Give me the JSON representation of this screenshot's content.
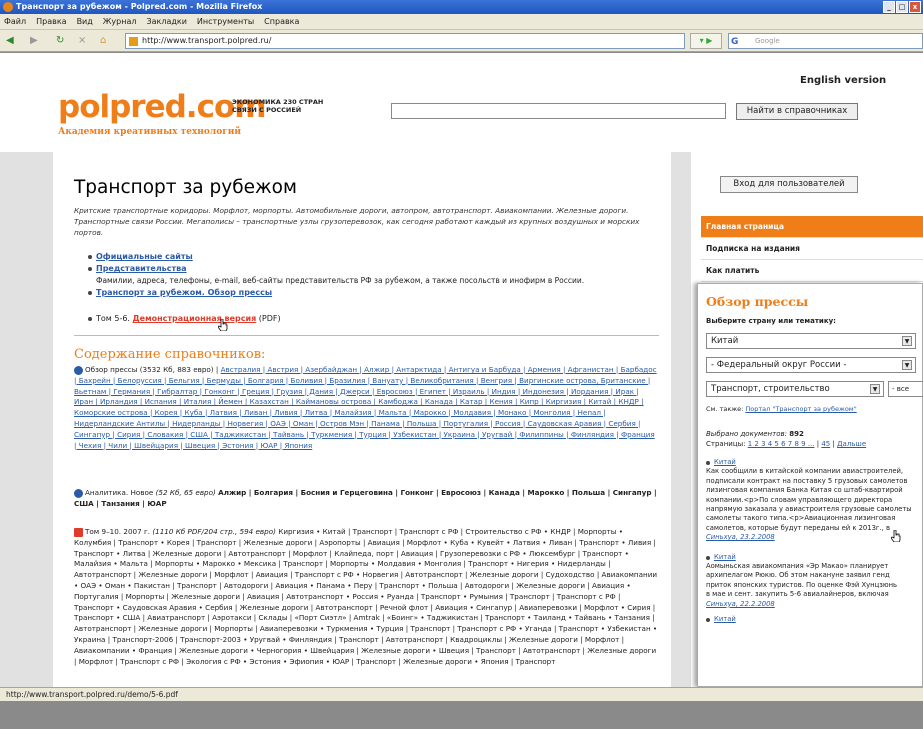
{
  "window": {
    "title": "Транспорт за рубежом - Polpred.com - Mozilla Firefox"
  },
  "menu": [
    "Файл",
    "Правка",
    "Вид",
    "Журнал",
    "Закладки",
    "Инструменты",
    "Справка"
  ],
  "nav": {
    "url": "http://www.transport.polpred.ru/",
    "search_placeholder": "Google"
  },
  "header": {
    "english": "English version",
    "logo": "polpred.com",
    "logo_sub": "Академия креативных технологий",
    "econ_line1": "ЭКОНОМИКА 230 СТРАН",
    "econ_line2": "СВЯЗИ С РОССИЕЙ",
    "search_button": "Найти в справочниках"
  },
  "main": {
    "title": "Транспорт за рубежом",
    "intro": "Критские транспортные коридоры. Морфлот, морпорты. Автомобильные дороги, автопром, автотранспорт. Авиакомпании. Железные дороги. Транспортные связи России. Мегаполисы – транспортные узлы грузоперевозок, как сегодня работают каждый из крупных воздушных и морских портов.",
    "link1": "Официальные сайты",
    "link2": "Представительства",
    "link2_desc": "Фамилии, адреса, телефоны, e-mail, веб-сайты представительств РФ за рубежом, а также посольств и инофирм в России.",
    "link3": "Транспорт за рубежом. Обзор прессы",
    "tom_prefix": "Том 5-6.",
    "tom_link": "Демонстрационная версия",
    "tom_suffix": "(PDF)",
    "contents_title": "Содержание справочников:",
    "block1_lead": "Обзор прессы (3532 Кб, 883 евро) |",
    "block1_countries": "Австралия | Австрия | Азербайджан | Алжир | Антарктида | Антигуа и Барбуда | Армения | Афганистан | Барбадос | Бахрейн | Белоруссия | Бельгия | Бермуды | Болгария | Боливия | Бразилия | Вануату | Великобритания | Венгрия | Виргинские острова, Британские | Вьетнам | Германия | Гибралтар | Гонконг | Греция | Грузия | Дания | Джерси | Евросоюз | Египет | Израиль | Индия | Индонезия | Иордания | Ирак | Иран | Ирландия | Испания | Италия | Йемен | Казахстан | Каймановы острова | Камбоджа | Канада | Катар | Кения | Кипр | Киргизия | Китай | КНДР | Коморские острова | Корея | Куба | Латвия | Ливан | Ливия | Литва | Малайзия | Мальта | Марокко | Молдавия | Монако | Монголия | Непал | Нидерландские Антилы | Нидерланды | Норвегия | ОАЭ | Оман | Остров Мэн | Панама | Польша | Португалия | Россия | Саудовская Аравия | Сербия | Сингапур | Сирия | Словакия | США | Таджикистан | Тайвань | Туркмения | Турция | Узбекистан | Украина | Уругвай | Филиппины | Финляндия | Франция | Чехия | Чили | Швейцария | Швеция | Эстония | ЮАР | Япония",
    "block2_lead": "Аналитика. Новое",
    "block2_meta": "(52 Кб, 65 евро)",
    "block2_text": "Алжир | Болгария | Босния и Герцеговина | Гонконг | Евросоюз | Канада | Марокко | Польша | Сингапур | США | Танзания | ЮАР",
    "block3_lead": "Том 9–10. 2007 г.",
    "block3_meta": "(1110 Кб PDF/204 стр., 594 евро)",
    "block3_text": "Киргизия • Китай | Транспорт | Транспорт с РФ | Строительство с РФ • КНДР | Морпорты • Колумбия | Транспорт • Корея | Транспорт | Железные дороги | Аэропорты | Авиация | Морфлот • Куба • Кувейт • Латвия • Ливан | Транспорт • Ливия | Транспорт • Литва | Железные дороги | Автотранспорт | Морфлот | Клайпеда, порт | Авиация | Грузоперевозки с РФ • Люксембург | Транспорт • Малайзия • Мальта | Морпорты • Марокко • Мексика | Транспорт | Морпорты • Молдавия • Монголия | Транспорт • Нигерия • Нидерланды | Автотранспорт | Железные дороги | Морфлот | Авиация | Транспорт с РФ • Норвегия | Автотранспорт | Железные дороги | Судоходство | Авиакомпании • ОАЭ • Оман • Пакистан | Транспорт | Автодороги | Авиация • Панама • Перу | Транспорт • Польша | Автодороги | Железные дороги | Авиация • Португалия | Морпорты | Железные дороги | Авиация | Автотранспорт • Россия • Руанда | Транспорт • Румыния | Транспорт | Транспорт с РФ | Транспорт • Саудовская Аравия • Сербия | Железные дороги | Автотранспорт | Речной флот | Авиация • Сингапур | Авиаперевозки | Морфлот • Сирия | Транспорт • США | Авиатранспорт | Аэротакси | Склады | «Порт Сиэтл» | Amtrak | «Боинг» • Таджикистан | Транспорт • Таиланд • Тайвань • Танзания | Автотранспорт | Железные дороги | Морпорты | Авиаперевозки • Туркмения • Турция | Транспорт | Транспорт с РФ • Уганда | Транспорт • Узбекистан • Украина | Транспорт-2006 | Транспорт-2003 • Уругвай • Финляндия | Транспорт | Автотранспорт | Квадроциклы | Железные дороги | Морфлот | Авиакомпании • Франция | Железные дороги • Черногория • Швейцария | Железные дороги • Швеция | Транспорт | Автотранспорт | Железные дороги | Морфлот | Транспорт с РФ | Экология с РФ • Эстония • Эфиопия • ЮАР | Транспорт | Железные дороги • Япония | Транспорт"
  },
  "sidebar": {
    "login": "Вход для пользователей",
    "items": [
      "Главная страница",
      "Подписка на издания",
      "Как платить"
    ]
  },
  "popup": {
    "title": "Обзор прессы",
    "subtitle": "Выберите страну или тематику:",
    "select1": "Китай",
    "select2": "- Федеральный округ России -",
    "select3": "Транспорт, строительство",
    "select3b": "- все",
    "see_prefix": "См. также:",
    "see_link": "Портал \"Транспорт за рубежом\"",
    "found_label": "Выбрано документов:",
    "found_count": "892",
    "pages_label": "Страницы:",
    "pages_nums": "1 2 3 4 5 6 7 8 9 ...",
    "pages_last": "45",
    "pages_next": "Дальше",
    "news1_title": "Китай",
    "news1_lines": [
      "Как сообщили в китайской компании авиастроителей,",
      "подписали контракт на поставку 5 грузовых самолетов",
      "лизинговая компания Банка Китая со штаб-квартирой",
      "компании.<p>По словам управляющего директора",
      "напрямую заказала у авиастроителя грузовые самолеты",
      "самолеты такого типа.<p>Авиационная лизинговая",
      "самолетов, которые будут переданы ей к 2013г., в"
    ],
    "news1_src": "Синьхуа, 23.2.2008",
    "news2_title": "Китай",
    "news2_lines": [
      "Аомыньская авиакомпания «Эр Макао» планирует",
      "архипелагом Рюкю. Об этом накануне заявил генд",
      "приток японских туристов. По оценке Фэй Хунцзюнь",
      "в мае и сент. закупить 5-6 авиалайнеров, включая"
    ],
    "news2_src": "Синьхуа, 22.2.2008",
    "news3_title": "Китай"
  },
  "status": {
    "text": "http://www.transport.polpred.ru/demo/5-6.pdf"
  }
}
